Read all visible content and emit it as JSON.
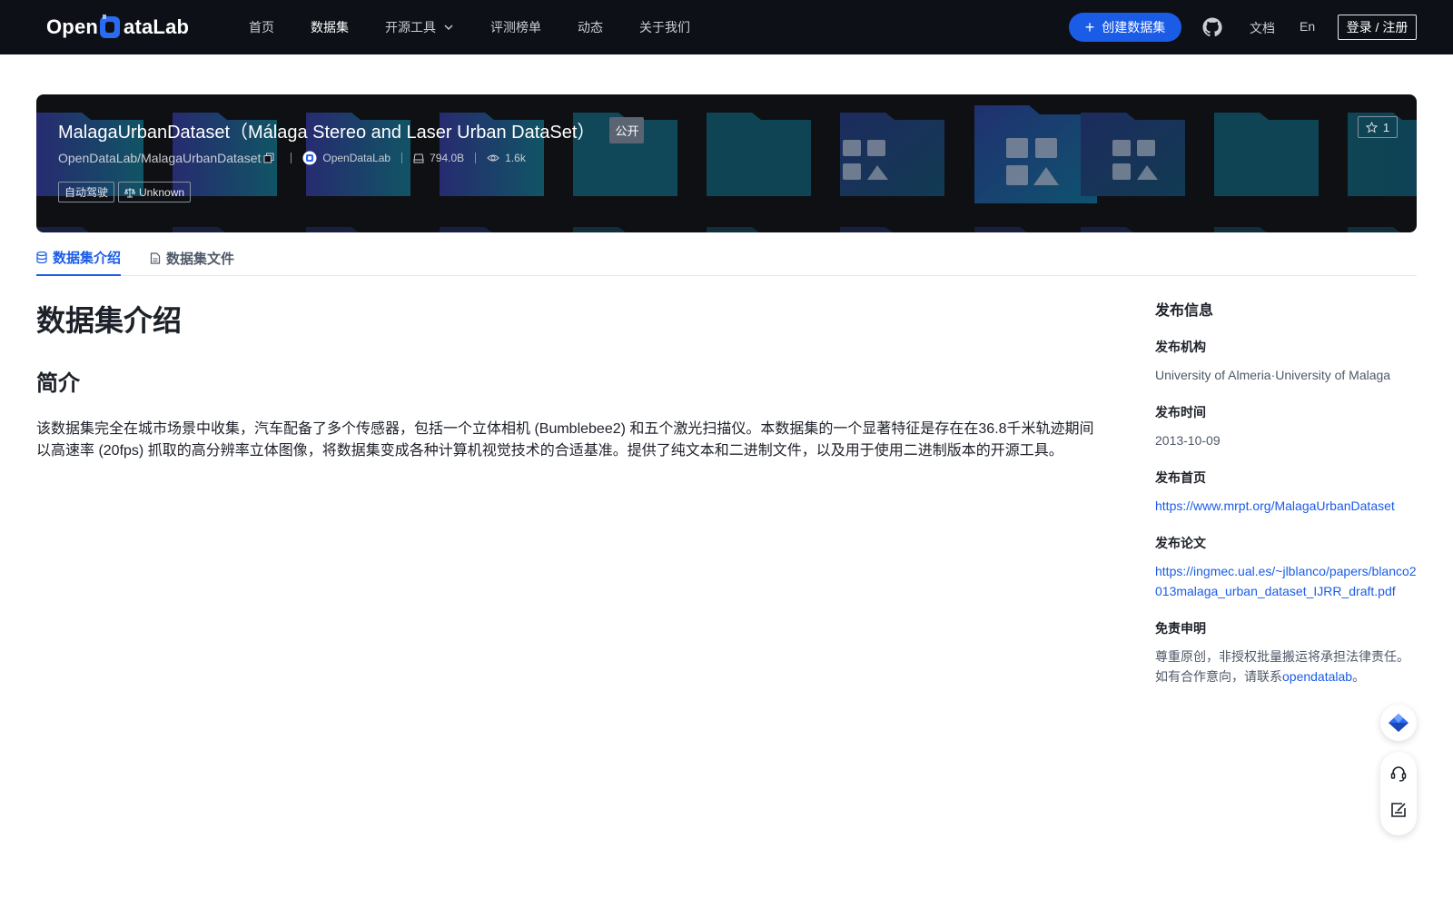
{
  "header": {
    "logo_text_a": "Open",
    "logo_text_b": "ataLab",
    "nav": [
      {
        "label": "首页"
      },
      {
        "label": "数据集"
      },
      {
        "label": "开源工具"
      },
      {
        "label": "评测榜单"
      },
      {
        "label": "动态"
      },
      {
        "label": "关于我们"
      }
    ],
    "create_label": "创建数据集",
    "docs_label": "文档",
    "lang_label": "En",
    "login_label": "登录 / 注册"
  },
  "banner": {
    "title": "MalagaUrbanDataset（Málaga Stereo and Laser Urban DataSet）",
    "visibility": "公开",
    "repo_path": "OpenDataLab/MalagaUrbanDataset",
    "owner": "OpenDataLab",
    "size": "794.0B",
    "views": "1.6k",
    "tag_category": "自动驾驶",
    "tag_license": "Unknown",
    "star_count": "1"
  },
  "tabs": [
    {
      "label": "数据集介绍"
    },
    {
      "label": "数据集文件"
    }
  ],
  "content": {
    "heading": "数据集介绍",
    "subheading": "简介",
    "paragraph": "该数据集完全在城市场景中收集，汽车配备了多个传感器，包括一个立体相机 (Bumblebee2) 和五个激光扫描仪。本数据集的一个显著特征是存在在36.8千米轨迹期间以高速率 (20fps) 抓取的高分辨率立体图像，将数据集变成各种计算机视觉技术的合适基准。提供了纯文本和二进制文件，以及用于使用二进制版本的开源工具。"
  },
  "sidebar": {
    "title": "发布信息",
    "publisher_label": "发布机构",
    "publisher_value": "University of Almeria·University of Malaga",
    "date_label": "发布时间",
    "date_value": "2013-10-09",
    "homepage_label": "发布首页",
    "homepage_value": "https://www.mrpt.org/MalagaUrbanDataset",
    "paper_label": "发布论文",
    "paper_value": "https://ingmec.ual.es/~jlblanco/papers/blanco2013malaga_urban_dataset_IJRR_draft.pdf",
    "disclaimer_label": "免责申明",
    "disclaimer_line1": "尊重原创，非授权批量搬运将承担法律责任。",
    "disclaimer_line2_prefix": "如有合作意向，请联系",
    "disclaimer_link": "opendatalab",
    "disclaimer_suffix": "。"
  },
  "colors": {
    "accent": "#1b5ce6",
    "header_bg": "#0d1117",
    "banner_bg": "#0f1014"
  }
}
